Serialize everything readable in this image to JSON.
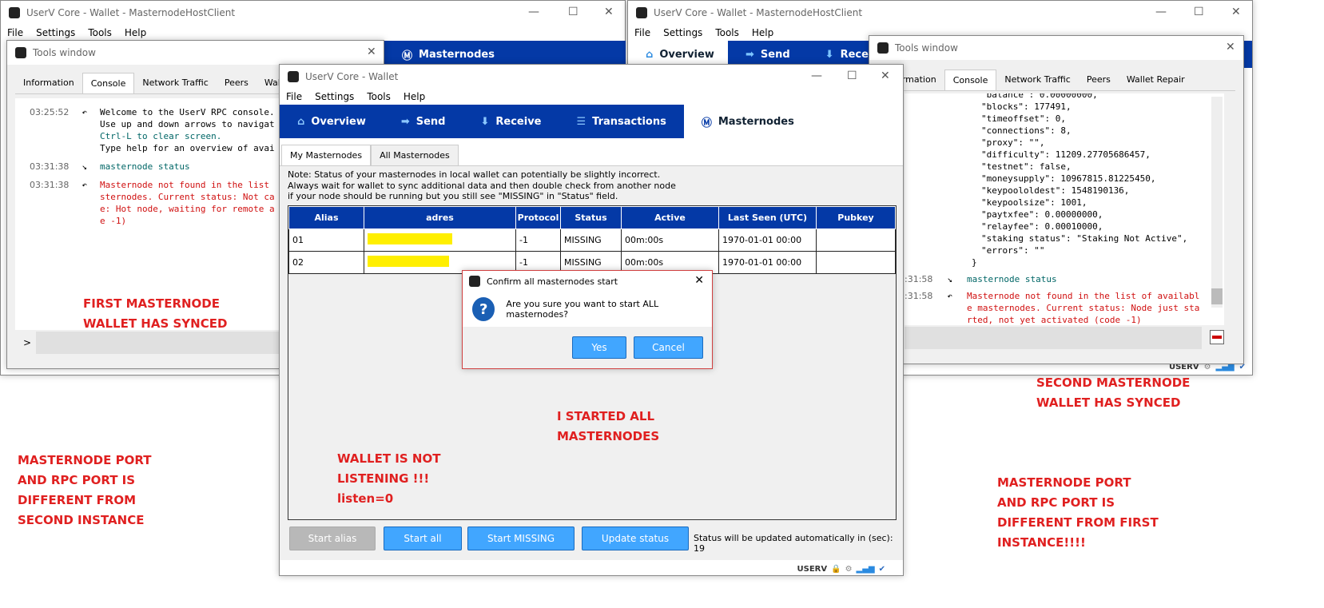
{
  "window_left": {
    "title": "UserV Core - Wallet - MasternodeHostClient",
    "menu": [
      "File",
      "Settings",
      "Tools",
      "Help"
    ],
    "nav_visible": "Masternodes",
    "tools": {
      "title": "Tools window",
      "tabs": [
        "Information",
        "Console",
        "Network Traffic",
        "Peers",
        "Wallet Repair"
      ],
      "lines": [
        {
          "time": "03:25:52",
          "text": [
            "Welcome to the UserV RPC console.",
            "Use up and down arrows to navigat",
            "Ctrl-L to clear screen.",
            "Type help for an overview of avai"
          ]
        },
        {
          "time": "03:31:38",
          "text": [
            "masternode status"
          ]
        },
        {
          "time": "03:31:38",
          "text": [
            "Masternode not found in the list",
            "sternodes. Current status: Not ca",
            "e: Hot node, waiting for remote a",
            "e -1)"
          ]
        }
      ],
      "prompt": ">"
    }
  },
  "window_right": {
    "title": "UserV Core - Wallet - MasternodeHostClient",
    "menu": [
      "File",
      "Settings",
      "Tools",
      "Help"
    ],
    "nav": [
      "Overview",
      "Send",
      "Recei"
    ],
    "tools": {
      "title": "Tools window",
      "tabs": [
        "Information",
        "Console",
        "Network Traffic",
        "Peers",
        "Wallet Repair"
      ],
      "json_lines": [
        "\"balance\": 0.00000000,",
        "\"blocks\": 177491,",
        "\"timeoffset\": 0,",
        "\"connections\": 8,",
        "\"proxy\": \"\",",
        "\"difficulty\": 11209.27705686457,",
        "\"testnet\": false,",
        "\"moneysupply\": 10967815.81225450,",
        "\"keypoololdest\": 1548190136,",
        "\"keypoolsize\": 1001,",
        "\"paytxfee\": 0.00000000,",
        "\"relayfee\": 0.00010000,",
        "\"staking status\": \"Staking Not Active\",",
        "\"errors\": \"\"",
        "}"
      ],
      "lines": [
        {
          "time": ":31:58",
          "text": [
            "masternode status"
          ]
        },
        {
          "time": ":31:58",
          "text": [
            "Masternode not found in the list of availabl",
            "e masternodes. Current status: Node just sta",
            "rted, not yet activated (code -1)"
          ]
        }
      ]
    },
    "statusbar": "USERV"
  },
  "main": {
    "title": "UserV Core - Wallet",
    "menu": [
      "File",
      "Settings",
      "Tools",
      "Help"
    ],
    "nav": [
      "Overview",
      "Send",
      "Receive",
      "Transactions",
      "Masternodes"
    ],
    "subtabs": [
      "My Masternodes",
      "All Masternodes"
    ],
    "note": [
      "Note: Status of your masternodes in local wallet can potentially be slightly incorrect.",
      "Always wait for wallet to sync additional data and then double check from another node",
      "if your node should be running but you still see \"MISSING\" in \"Status\" field."
    ],
    "columns": [
      "Alias",
      "adres",
      "Protocol",
      "Status",
      "Active",
      "Last Seen (UTC)",
      "Pubkey"
    ],
    "rows": [
      {
        "alias": "01",
        "protocol": "-1",
        "status": "MISSING",
        "active": "00m:00s",
        "last_seen": "1970-01-01 00:00",
        "pubkey": ""
      },
      {
        "alias": "02",
        "protocol": "-1",
        "status": "MISSING",
        "active": "00m:00s",
        "last_seen": "1970-01-01 00:00",
        "pubkey": ""
      }
    ],
    "buttons": {
      "start_alias": "Start alias",
      "start_all": "Start all",
      "start_missing": "Start MISSING",
      "update_status": "Update status"
    },
    "auto_update_label": "Status will be updated automatically in (sec):",
    "auto_update_seconds": "19",
    "statusbar": "USERV",
    "accent": "#0439a6"
  },
  "dialog": {
    "title": "Confirm all masternodes start",
    "message": "Are you sure you want to start ALL masternodes?",
    "yes": "Yes",
    "cancel": "Cancel"
  },
  "annotations": {
    "a1": "FIRST MASTERNODE\nWALLET HAS SYNCED",
    "a2": "MASTERNODE PORT\nAND RPC PORT IS\nDIFFERENT FROM\nSECOND INSTANCE",
    "a3": "WALLET IS NOT\nLISTENING !!!\nlisten=0",
    "a4": "I STARTED ALL\nMASTERNODES",
    "a5": "SECOND MASTERNODE\nWALLET HAS SYNCED",
    "a6": "MASTERNODE PORT\nAND RPC PORT IS\nDIFFERENT FROM FIRST\nINSTANCE!!!!"
  }
}
